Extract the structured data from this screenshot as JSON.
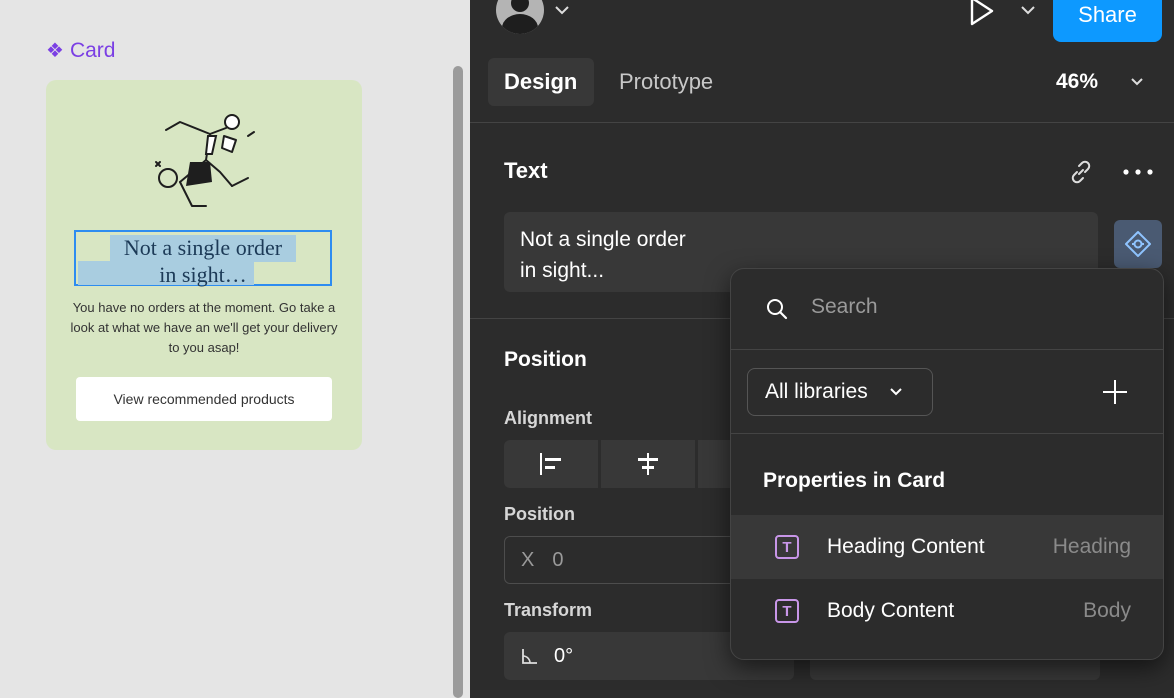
{
  "canvas": {
    "frame_label": "Card",
    "card": {
      "heading": "Not a single order in sight…",
      "heading_line1": "Not a single order",
      "heading_line2": "in sight…",
      "body": "You have no orders at the moment. Go take a look at what we have an we'll get your delivery to you asap!",
      "cta_label": "View recommended products"
    }
  },
  "topbar": {
    "share_label": "Share"
  },
  "tabs": [
    {
      "label": "Design",
      "active": true
    },
    {
      "label": "Prototype",
      "active": false
    }
  ],
  "zoom": "46%",
  "text_section": {
    "title": "Text",
    "value_line1": "Not a single order",
    "value_line2": "in sight..."
  },
  "position_section": {
    "title": "Position",
    "alignment_label": "Alignment",
    "position_label": "Position",
    "x_label": "X",
    "x_value": "0",
    "transform_label": "Transform",
    "rotation_value": "0°"
  },
  "dropdown": {
    "search_placeholder": "Search",
    "library_select": "All libraries",
    "section_heading": "Properties in Card",
    "properties": [
      {
        "name": "Heading Content",
        "type": "Heading"
      },
      {
        "name": "Body Content",
        "type": "Body"
      }
    ]
  },
  "colors": {
    "accent": "#0d99ff",
    "component_purple": "#7b3fe4",
    "card_bg": "#d8e6c3",
    "panel_bg": "#2c2c2c"
  }
}
